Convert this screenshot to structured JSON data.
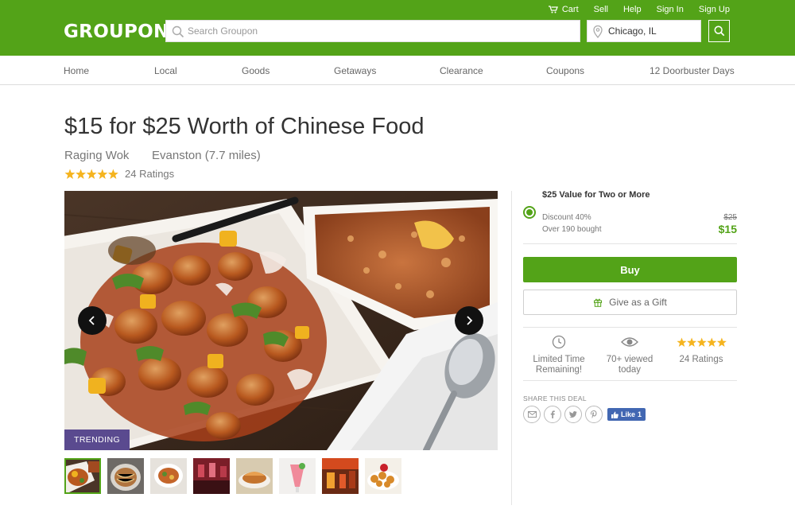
{
  "brand": {
    "logo": "GROUPON",
    "color": "#53a318"
  },
  "toplinks": {
    "cart": "Cart",
    "sell": "Sell",
    "help": "Help",
    "signin": "Sign In",
    "signup": "Sign Up"
  },
  "search": {
    "placeholder": "Search Groupon",
    "location": "Chicago, IL"
  },
  "nav": [
    "Home",
    "Local",
    "Goods",
    "Getaways",
    "Clearance",
    "Coupons",
    "12 Doorbuster Days"
  ],
  "deal": {
    "title": "$15 for $25 Worth of Chinese Food",
    "merchant": "Raging Wok",
    "location": "Evanston (7.7 miles)",
    "ratings_text": "24 Ratings",
    "star_rating": 5,
    "badge": "TRENDING"
  },
  "option": {
    "title": "$25 Value for Two or More",
    "discount": "Discount 40%",
    "bought": "Over 190 bought",
    "old_price": "$25",
    "new_price": "$15"
  },
  "actions": {
    "buy": "Buy",
    "gift": "Give as a Gift"
  },
  "features": {
    "limited": [
      "Limited Time",
      "Remaining!"
    ],
    "viewed": [
      "70+ viewed",
      "today"
    ],
    "ratings": "24 Ratings"
  },
  "share": {
    "label": "SHARE THIS DEAL",
    "fb_like": "Like",
    "fb_count": "1"
  },
  "colors": {
    "accent": "#53a318",
    "star": "#f5b41f",
    "badge": "#5a4a8f",
    "fb": "#4267b2"
  }
}
